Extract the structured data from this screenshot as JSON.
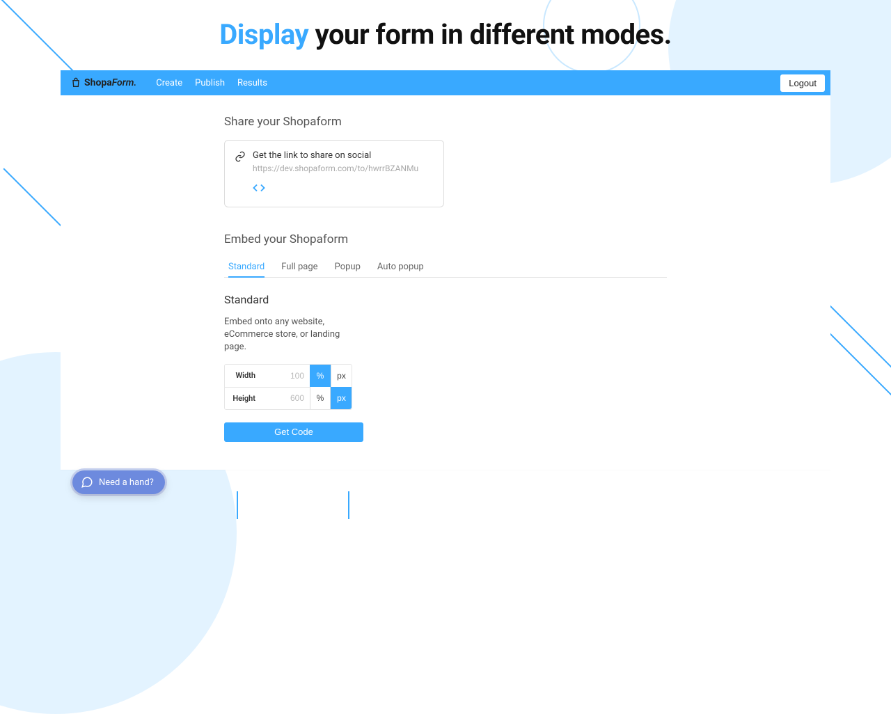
{
  "headline": {
    "prefix": "Display",
    "rest": " your form in different modes."
  },
  "brand": {
    "shopa": "Shopa",
    "form": "Form."
  },
  "nav": {
    "create": "Create",
    "publish": "Publish",
    "results": "Results"
  },
  "logout": "Logout",
  "share": {
    "title": "Share your Shopaform",
    "label": "Get the link to share on social",
    "url": "https://dev.shopaform.com/to/hwrrBZANMu"
  },
  "embed": {
    "title": "Embed your Shopaform",
    "tabs": {
      "standard": "Standard",
      "fullpage": "Full page",
      "popup": "Popup",
      "autopopup": "Auto popup"
    },
    "panel": {
      "title": "Standard",
      "desc": "Embed onto any website, eCommerce store, or landing page.",
      "width_label": "Width",
      "width_value": "100",
      "height_label": "Height",
      "height_value": "600",
      "unit_pct": "%",
      "unit_px": "px",
      "get_code": "Get Code"
    }
  },
  "help": {
    "label": "Need a hand?"
  },
  "colors": {
    "accent": "#39a9ff",
    "help_bg": "#6d8ade"
  }
}
